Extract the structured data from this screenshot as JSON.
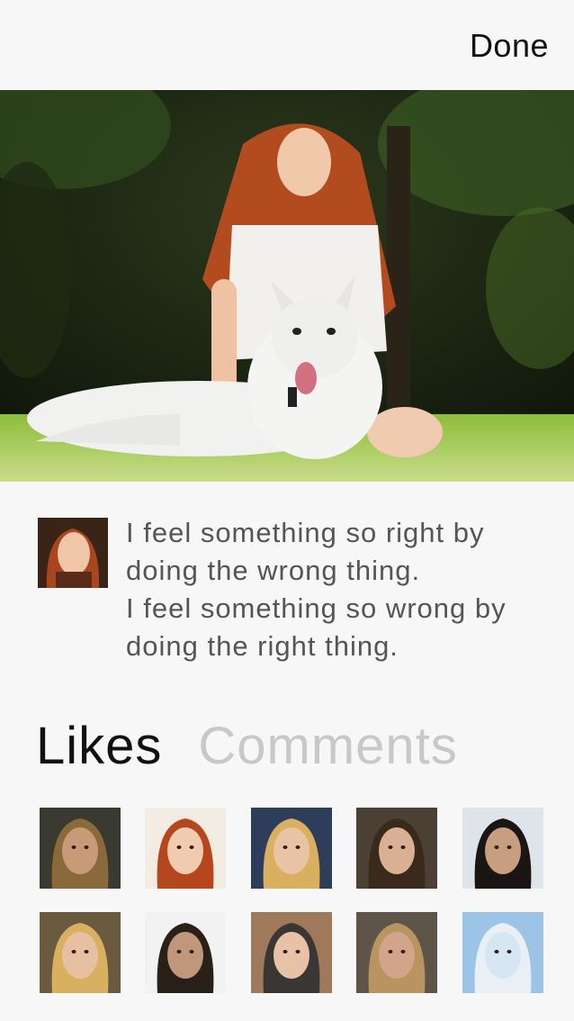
{
  "header": {
    "done_label": "Done"
  },
  "post": {
    "caption_lines": [
      "I feel something so right by",
      "doing the wrong thing.",
      "I feel something so wrong by",
      "doing the right thing."
    ]
  },
  "tabs": [
    {
      "label": "Likes",
      "active": true
    },
    {
      "label": "Comments",
      "active": false
    }
  ],
  "likes": [
    {
      "name": "liker-avatar-1",
      "bg": "#3a3a30",
      "skin": "#c99a78",
      "hair": "#8a6a3a"
    },
    {
      "name": "liker-avatar-2",
      "bg": "#f3ece2",
      "skin": "#f0cbb0",
      "hair": "#b5471e"
    },
    {
      "name": "liker-avatar-3",
      "bg": "#2d3d5a",
      "skin": "#e8c4a4",
      "hair": "#d9b060"
    },
    {
      "name": "liker-avatar-4",
      "bg": "#4a4034",
      "skin": "#d9b094",
      "hair": "#3a2a1c"
    },
    {
      "name": "liker-avatar-5",
      "bg": "#dfe4ea",
      "skin": "#c89e80",
      "hair": "#1a1614"
    },
    {
      "name": "liker-avatar-6",
      "bg": "#6a5a40",
      "skin": "#e6c0a0",
      "hair": "#d8b060"
    },
    {
      "name": "liker-avatar-7",
      "bg": "#f2f2f2",
      "skin": "#c0977a",
      "hair": "#2a2018"
    },
    {
      "name": "liker-avatar-8",
      "bg": "#a0785a",
      "skin": "#e8c2a6",
      "hair": "#3a3634"
    },
    {
      "name": "liker-avatar-9",
      "bg": "#5e5448",
      "skin": "#d2a48a",
      "hair": "#b89460"
    },
    {
      "name": "liker-avatar-10",
      "bg": "#9cc4e6",
      "skin": "#d6e6f2",
      "hair": "#e8f0f6"
    }
  ]
}
